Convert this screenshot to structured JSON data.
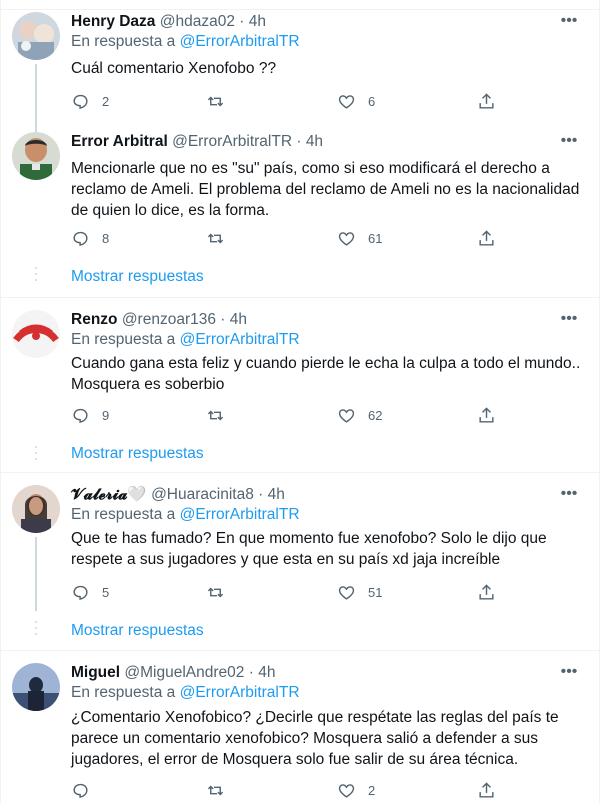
{
  "tweets": [
    {
      "name": "Henry Daza",
      "handle": "@hdaza02",
      "time": "4h",
      "reply_prefix": "En respuesta a ",
      "reply_mention": "@ErrorArbitralTR",
      "text": "Cuál comentario Xenofobo ??",
      "replies": "2",
      "retweets": "",
      "likes": "6",
      "avatar_color": "#a9b9c8"
    },
    {
      "name": "Error Arbitral",
      "handle": "@ErrorArbitralTR",
      "time": "4h",
      "text": "Mencionarle que no es \"su\" país, como si eso modificará el derecho a reclamo de Ameli. El problema del reclamo de Ameli no es la nacionalidad de quien lo dice, es la forma.",
      "replies": "8",
      "retweets": "",
      "likes": "61",
      "show_replies": "Mostrar respuestas",
      "avatar_color": "#3a5a3a"
    },
    {
      "name": "Renzo",
      "handle": "@renzoar136",
      "time": "4h",
      "reply_prefix": "En respuesta a ",
      "reply_mention": "@ErrorArbitralTR",
      "text": "Cuando gana esta feliz y cuando pierde le echa la culpa a todo el mundo.. Mosquera es soberbio",
      "replies": "9",
      "retweets": "",
      "likes": "62",
      "show_replies": "Mostrar respuestas",
      "avatar_color": "#d62f2f"
    },
    {
      "name": "𝓥𝓪𝓵𝓮𝓻𝓲𝓪🤍",
      "handle": "@Huaracinita8",
      "time": "4h",
      "reply_prefix": "En respuesta a ",
      "reply_mention": "@ErrorArbitralTR",
      "text": "Que te has fumado? En que momento fue xenofobo? Solo le dijo que respete a sus jugadores y que esta en su país xd jaja increíble",
      "replies": "5",
      "retweets": "",
      "likes": "51",
      "show_replies": "Mostrar respuestas",
      "avatar_color": "#5b4a42"
    },
    {
      "name": "Miguel",
      "handle": "@MiguelAndre02",
      "time": "4h",
      "reply_prefix": "En respuesta a ",
      "reply_mention": "@ErrorArbitralTR",
      "text": "¿Comentario Xenofobico? ¿Decirle que respétate las reglas del país te parece un comentario xenofobico? Mosquera salió a defender a sus jugadores, el error de Mosquera solo fue salir de su área técnica.",
      "replies": "",
      "retweets": "",
      "likes": "2",
      "avatar_color": "#2b3f66"
    }
  ],
  "separator": "·",
  "icons": {
    "reply": "reply-icon",
    "retweet": "retweet-icon",
    "like": "heart-icon",
    "share": "share-icon",
    "more": "more-icon"
  },
  "colors": {
    "accent": "#1d9bf0",
    "text": "#0f1419",
    "secondary": "#536471",
    "divider": "#eff3f4"
  }
}
